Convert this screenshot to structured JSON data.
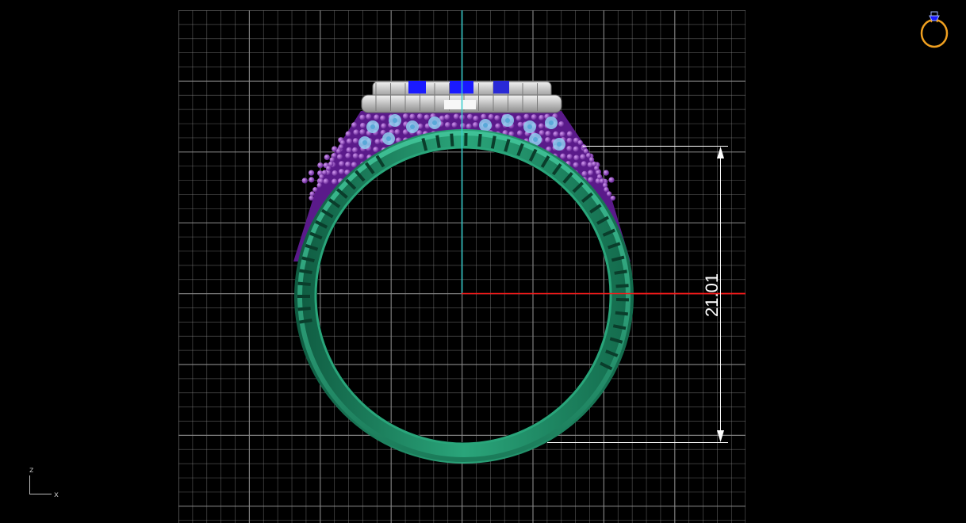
{
  "viewport": {
    "background": "#000000",
    "grid_color": "#8c8c8c",
    "axis_x_color": "#ff1a1a",
    "axis_z_color": "#33cccc"
  },
  "dimension": {
    "value": "21.01",
    "color": "#ffffff"
  },
  "axes_indicator": {
    "vertical": "z",
    "horizontal": "x"
  },
  "ring_model": {
    "band_color": "#1f8c66",
    "pave_stone_color": "#8a2fc0",
    "setting_color": "#8fd0f0",
    "crown_metal_color": "#d8d8d8",
    "center_stone_color": "#1a1aff"
  },
  "view_icon": {
    "name": "ring-view-icon",
    "color": "#f0a020"
  }
}
